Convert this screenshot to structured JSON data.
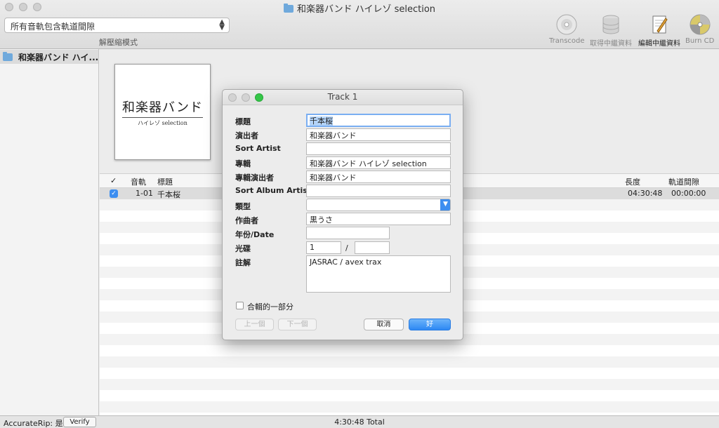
{
  "window": {
    "title": "和楽器バンド ハイレゾ selection"
  },
  "toolbar": {
    "filter_select": "所有音軌包含軌道間隙",
    "unzip_mode": "解壓縮模式",
    "tools": [
      {
        "label": "Transcode",
        "icon": "cd-disc-icon"
      },
      {
        "label": "取得中繼資料",
        "icon": "database-icon"
      },
      {
        "label": "編輯中繼資料",
        "icon": "edit-notes-icon"
      },
      {
        "label": "Burn CD",
        "icon": "burn-disc-icon"
      }
    ]
  },
  "sidebar": {
    "items": [
      {
        "label": "和楽器バンド ハイ..."
      }
    ]
  },
  "album_art": {
    "main_text": "和楽器バンド",
    "sub_text": "ハイレゾ selection"
  },
  "table": {
    "headers": {
      "check": "✓",
      "track": "音軌",
      "title": "標題",
      "length": "長度",
      "gap": "軌道間隙"
    },
    "rows": [
      {
        "checked": true,
        "track": "1-01",
        "title": "千本桜",
        "length": "04:30:48",
        "gap": "00:00:00"
      }
    ]
  },
  "status": {
    "accuraterip_label": "AccurateRip: 是",
    "verify_button": "Verify",
    "total": "4:30:48 Total"
  },
  "dialog": {
    "title": "Track 1",
    "labels": {
      "title": "標題",
      "artist": "演出者",
      "sort_artist": "Sort Artist",
      "album": "專輯",
      "album_artist": "專輯演出者",
      "sort_album_artist": "Sort Album Artist",
      "genre": "類型",
      "composer": "作曲者",
      "year": "年份/Date",
      "disc": "光碟",
      "comment": "註解"
    },
    "values": {
      "title": "千本桜",
      "artist": "和楽器バンド",
      "sort_artist": "",
      "album": "和楽器バンド ハイレゾ selection",
      "album_artist": "和楽器バンド",
      "sort_album_artist": "",
      "genre": "",
      "composer": "黒うさ",
      "year": "",
      "disc_number": "1",
      "disc_separator": "/",
      "disc_total": "",
      "comment": "JASRAC / avex trax"
    },
    "compilation_label": "合輯的一部分",
    "buttons": {
      "prev": "上一個",
      "next": "下一個",
      "cancel": "取消",
      "ok": "好"
    }
  }
}
